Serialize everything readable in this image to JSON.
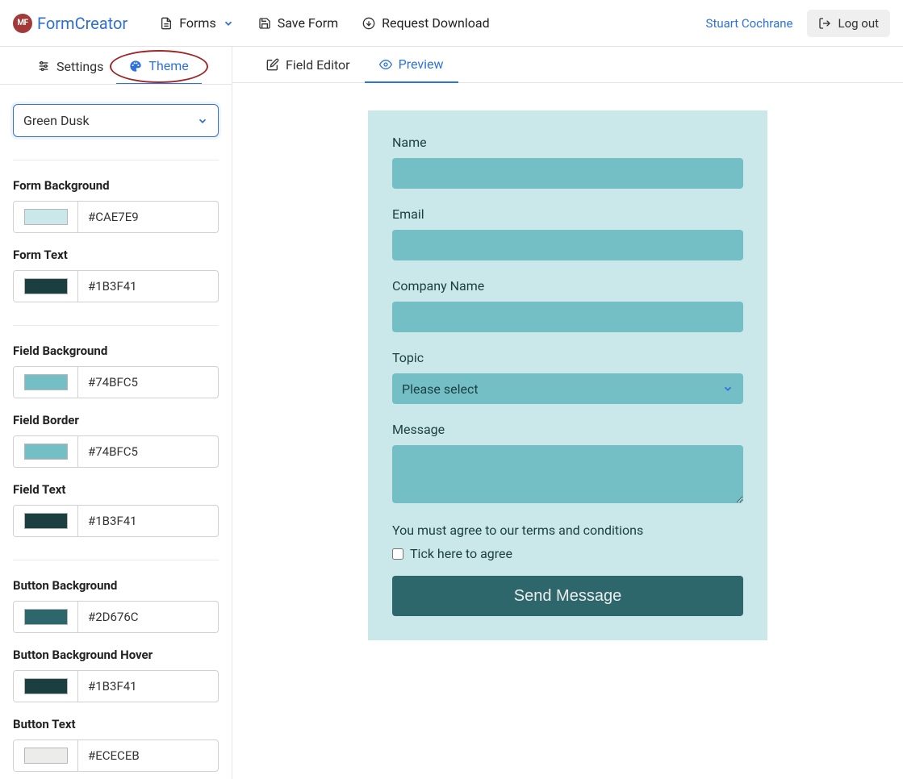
{
  "brand": {
    "badge": "MF",
    "name": "FormCreator"
  },
  "topbar": {
    "forms": "Forms",
    "save": "Save Form",
    "download": "Request Download",
    "user": "Stuart Cochrane",
    "logout": "Log out"
  },
  "sidebar": {
    "tabs": {
      "settings": "Settings",
      "theme": "Theme"
    },
    "theme_select": "Green Dusk",
    "groups": [
      {
        "title": "Form Background",
        "hex": "#CAE7E9",
        "swatch": "#CAE7E9"
      },
      {
        "title": "Form Text",
        "hex": "#1B3F41",
        "swatch": "#1B3F41"
      }
    ],
    "groups2": [
      {
        "title": "Field Background",
        "hex": "#74BFC5",
        "swatch": "#74BFC5"
      },
      {
        "title": "Field Border",
        "hex": "#74BFC5",
        "swatch": "#74BFC5"
      },
      {
        "title": "Field Text",
        "hex": "#1B3F41",
        "swatch": "#1B3F41"
      }
    ],
    "groups3": [
      {
        "title": "Button Background",
        "hex": "#2D676C",
        "swatch": "#2D676C"
      },
      {
        "title": "Button Background Hover",
        "hex": "#1B3F41",
        "swatch": "#1B3F41"
      },
      {
        "title": "Button Text",
        "hex": "#ECECEB",
        "swatch": "#ECECEB"
      }
    ]
  },
  "mainTabs": {
    "editor": "Field Editor",
    "preview": "Preview"
  },
  "form": {
    "colors": {
      "bg": "#CAE7E9",
      "text": "#1B3F41",
      "field_bg": "#74BFC5",
      "button_bg": "#2D676C",
      "button_text": "#ECECEB"
    },
    "labels": {
      "name": "Name",
      "email": "Email",
      "company": "Company Name",
      "topic": "Topic",
      "topic_placeholder": "Please select",
      "message": "Message",
      "terms": "You must agree to our terms and conditions",
      "tick": "Tick here to agree",
      "submit": "Send Message"
    }
  }
}
